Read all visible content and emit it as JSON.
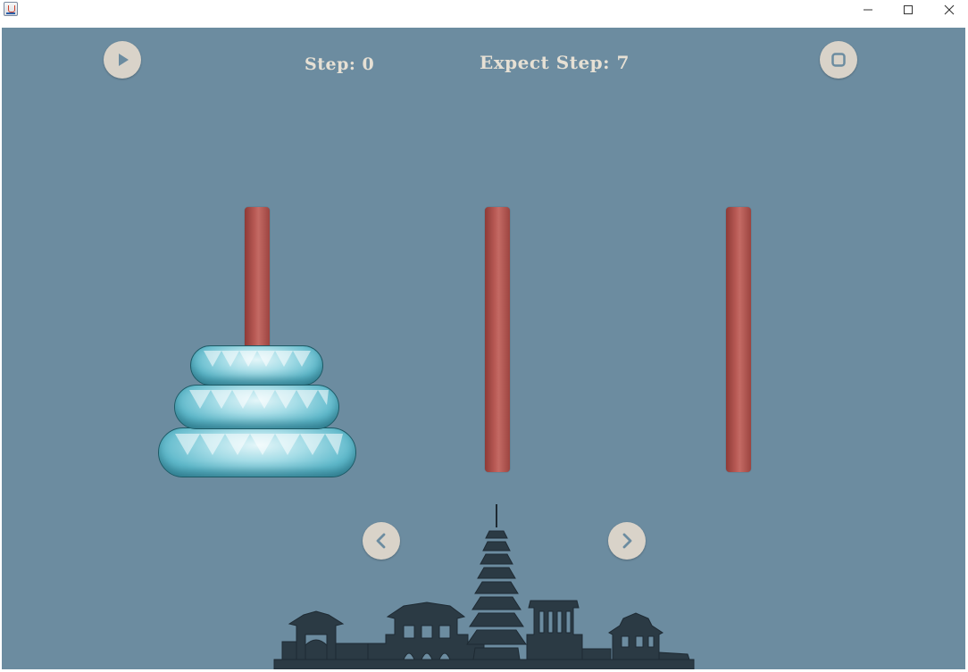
{
  "window": {
    "icons": {
      "app": "java-cup-icon",
      "minimize": "minimize-icon",
      "maximize": "maximize-icon",
      "close": "close-icon"
    }
  },
  "hud": {
    "step_text": "Step: 0",
    "expect_text": "Expect Step: 7"
  },
  "controls": {
    "play_icon": "play-icon",
    "stop_icon": "stop-icon",
    "prev_icon": "chevron-left-icon",
    "next_icon": "chevron-right-icon"
  },
  "game": {
    "rods": 3,
    "disks_on_rod": [
      3,
      0,
      0
    ],
    "colors": {
      "background": "#6c8ca0",
      "rod": "#b35550",
      "disk": "#6cc2d3",
      "button": "#d9d3c9",
      "text": "#e6e0d4"
    }
  }
}
